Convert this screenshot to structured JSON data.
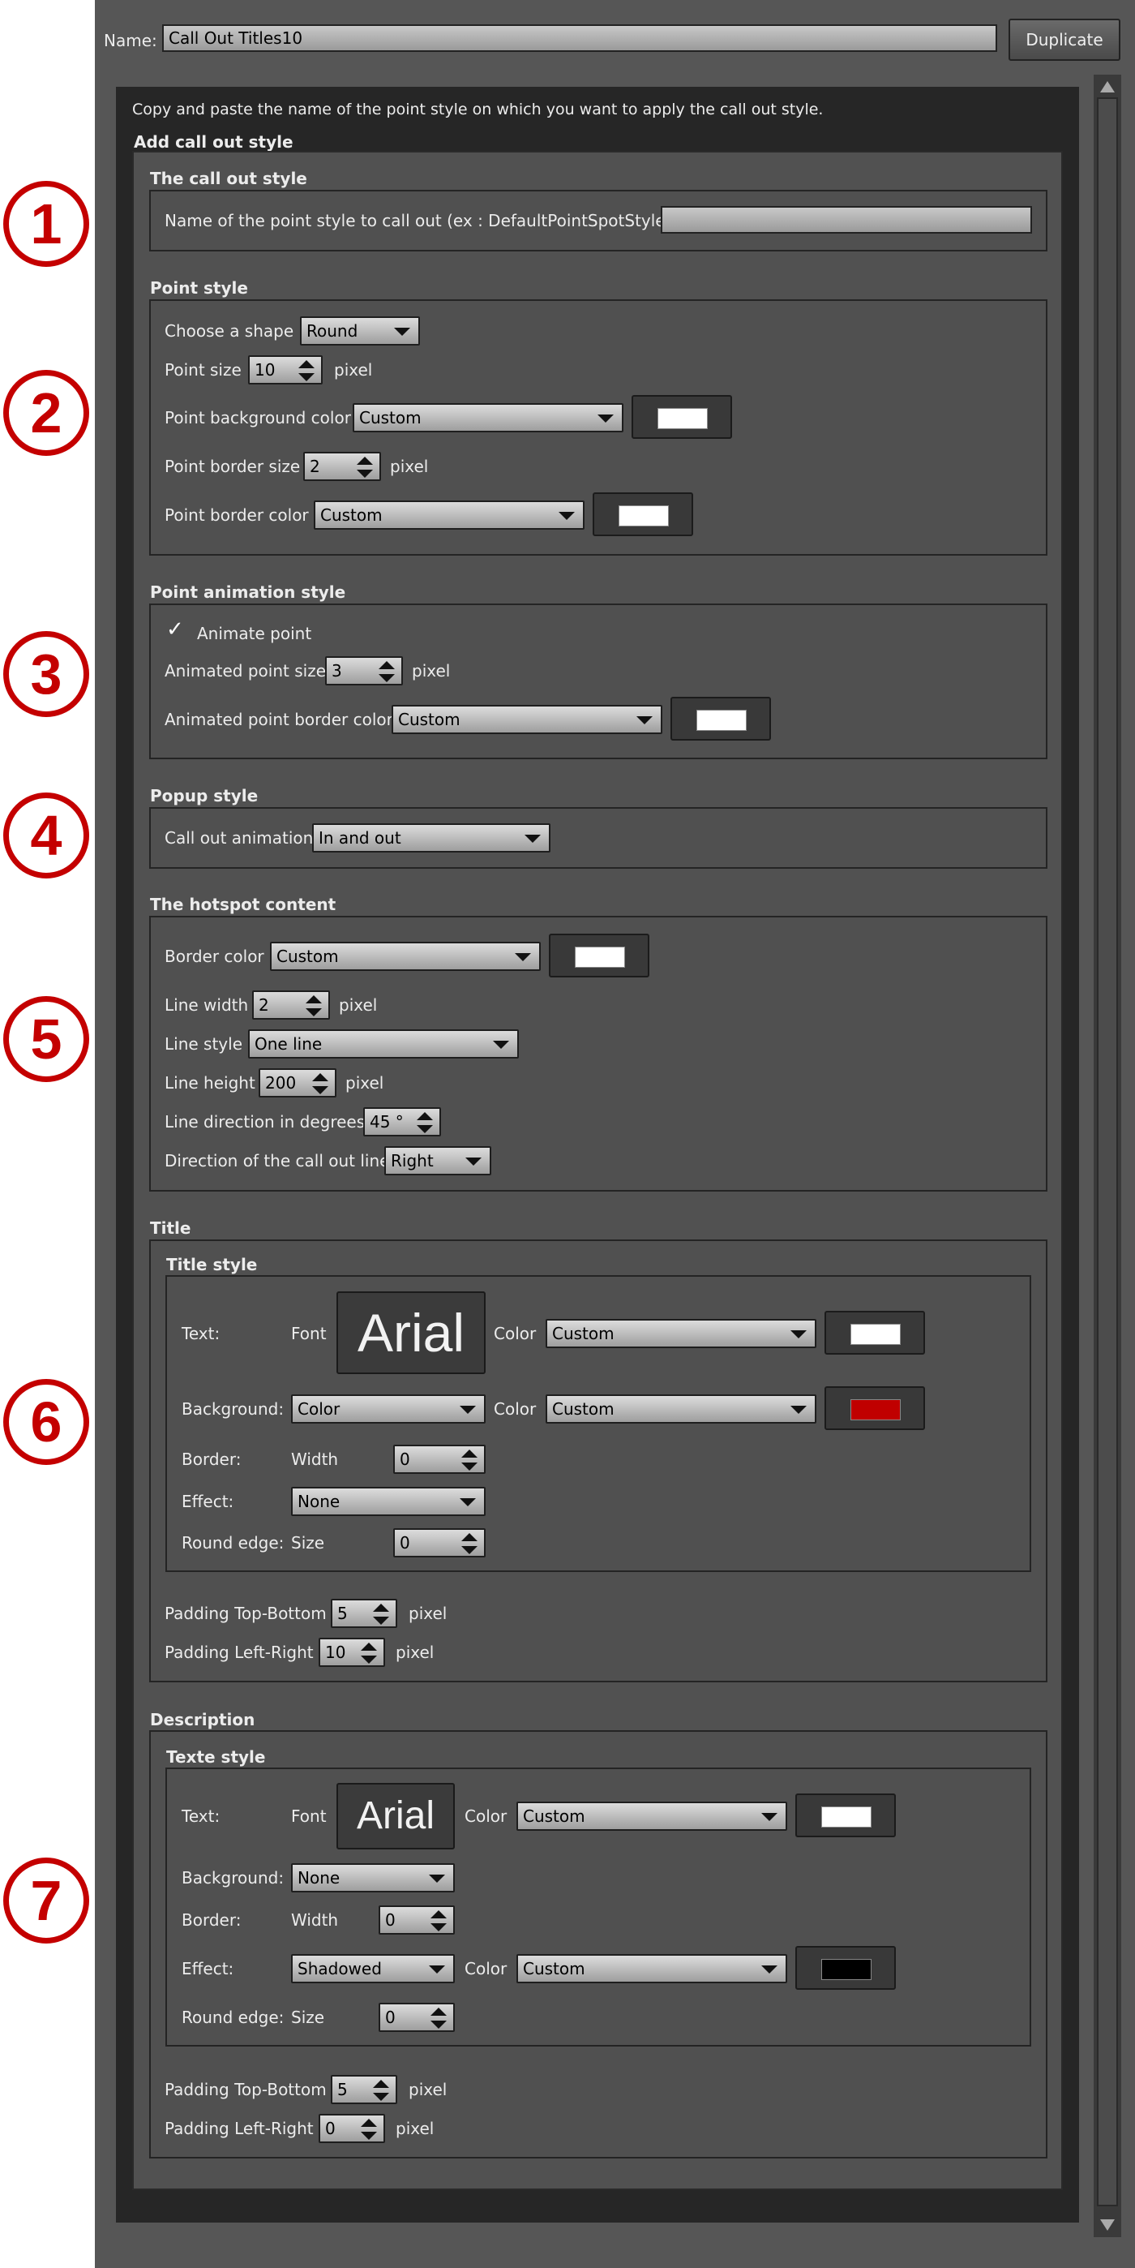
{
  "header": {
    "name_label": "Name:",
    "name_value": "Call Out Titles10",
    "duplicate_label": "Duplicate"
  },
  "intro": {
    "instruction": "Copy and paste the name of the point style on which you want to apply the call out style.",
    "section_title": "Add call out style"
  },
  "badges": [
    "1",
    "2",
    "3",
    "4",
    "5",
    "6",
    "7"
  ],
  "callout": {
    "title": "The call out style",
    "name_label": "Name of the point style to call out (ex : DefaultPointSpotStyle)",
    "name_value": ""
  },
  "point": {
    "title": "Point style",
    "shape_label": "Choose a shape",
    "shape_value": "Round",
    "size_label": "Point size",
    "size_value": "10",
    "size_unit": "pixel",
    "bg_label": "Point background color",
    "bg_value": "Custom",
    "bg_color": "#ffffff",
    "border_size_label": "Point border size",
    "border_size_value": "2",
    "border_size_unit": "pixel",
    "border_color_label": "Point border color",
    "border_color_value": "Custom",
    "border_color": "#ffffff"
  },
  "anim": {
    "title": "Point animation style",
    "animate_label": "Animate point",
    "animate_checked": true,
    "size_label": "Animated point size",
    "size_value": "3",
    "size_unit": "pixel",
    "border_color_label": "Animated point border color",
    "border_color_value": "Custom",
    "border_color": "#ffffff"
  },
  "popup": {
    "title": "Popup style",
    "anim_label": "Call out animation",
    "anim_value": "In and out"
  },
  "hotspot": {
    "title": "The hotspot content",
    "border_color_label": "Border color",
    "border_color_value": "Custom",
    "border_color": "#ffffff",
    "line_width_label": "Line width",
    "line_width_value": "2",
    "line_width_unit": "pixel",
    "line_style_label": "Line style",
    "line_style_value": "One line",
    "line_height_label": "Line height",
    "line_height_value": "200",
    "line_height_unit": "pixel",
    "line_dir_label": "Line direction in degrees",
    "line_dir_value": "45 °",
    "call_dir_label": "Direction of the call out line",
    "call_dir_value": "Right"
  },
  "title_sec": {
    "title": "Title",
    "style_title": "Title style",
    "text_label": "Text:",
    "font_label": "Font",
    "font_value": "Arial",
    "color_label": "Color",
    "text_color_value": "Custom",
    "text_color": "#ffffff",
    "bg_label": "Background:",
    "bg_value": "Color",
    "bg_color_label": "Color",
    "bg_color_value": "Custom",
    "bg_color": "#c00000",
    "border_label": "Border:",
    "width_label": "Width",
    "width_value": "0",
    "effect_label": "Effect:",
    "effect_value": "None",
    "round_label": "Round edge:",
    "size_label": "Size",
    "size_value": "0",
    "pad_tb_label": "Padding Top-Bottom",
    "pad_tb_value": "5",
    "pad_tb_unit": "pixel",
    "pad_lr_label": "Padding Left-Right",
    "pad_lr_value": "10",
    "pad_lr_unit": "pixel"
  },
  "desc": {
    "title": "Description",
    "style_title": "Texte style",
    "text_label": "Text:",
    "font_label": "Font",
    "font_value": "Arial",
    "color_label": "Color",
    "text_color_value": "Custom",
    "text_color": "#ffffff",
    "bg_label": "Background:",
    "bg_value": "None",
    "border_label": "Border:",
    "width_label": "Width",
    "width_value": "0",
    "effect_label": "Effect:",
    "effect_value": "Shadowed",
    "effect_color_label": "Color",
    "effect_color_value": "Custom",
    "effect_color": "#000000",
    "round_label": "Round edge:",
    "size_label": "Size",
    "size_value": "0",
    "pad_tb_label": "Padding Top-Bottom",
    "pad_tb_value": "5",
    "pad_tb_unit": "pixel",
    "pad_lr_label": "Padding Left-Right",
    "pad_lr_value": "0",
    "pad_lr_unit": "pixel"
  }
}
